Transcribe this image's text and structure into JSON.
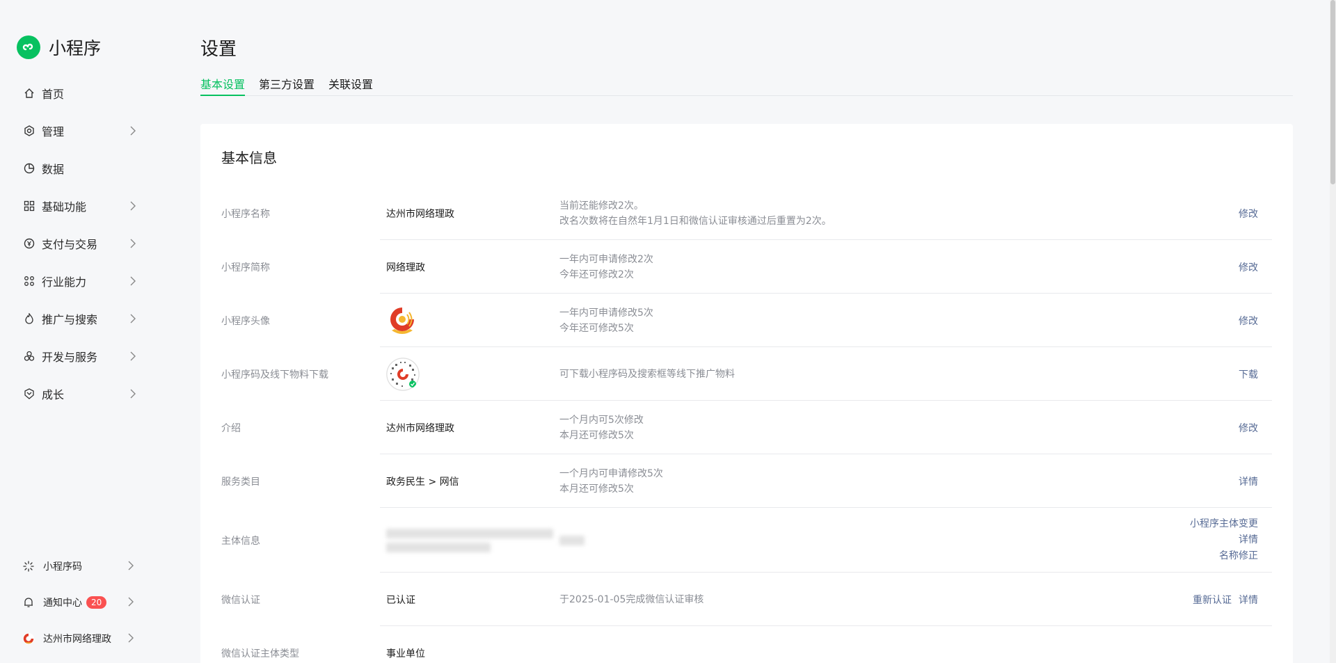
{
  "brand": {
    "title": "小程序"
  },
  "nav": [
    {
      "label": "首页",
      "icon": "home-icon"
    },
    {
      "label": "管理",
      "icon": "settings-icon"
    },
    {
      "label": "数据",
      "icon": "data-pie-icon"
    },
    {
      "label": "基础功能",
      "icon": "grid-icon"
    },
    {
      "label": "支付与交易",
      "icon": "payment-icon"
    },
    {
      "label": "行业能力",
      "icon": "industry-icon"
    },
    {
      "label": "推广与搜索",
      "icon": "promotion-icon"
    },
    {
      "label": "开发与服务",
      "icon": "dev-service-icon"
    },
    {
      "label": "成长",
      "icon": "growth-icon"
    }
  ],
  "bottom_nav": {
    "qrcode": {
      "label": "小程序码",
      "icon": "qrcode-icon"
    },
    "notify": {
      "label": "通知中心",
      "badge": "20",
      "icon": "bell-icon"
    },
    "account": {
      "label": "达州市网络理政",
      "icon": "account-avatar-icon"
    }
  },
  "page": {
    "title": "设置",
    "tabs": [
      "基本设置",
      "第三方设置",
      "关联设置"
    ]
  },
  "card": {
    "title": "基本信息",
    "rows": [
      {
        "label": "小程序名称",
        "value": "达州市网络理政",
        "desc": [
          "当前还能修改2次。",
          "改名次数将在自然年1月1日和微信认证审核通过后重置为2次。"
        ],
        "actions": [
          "修改"
        ]
      },
      {
        "label": "小程序简称",
        "value": "网络理政",
        "desc": [
          "一年内可申请修改2次",
          "今年还可修改2次"
        ],
        "actions": [
          "修改"
        ]
      },
      {
        "label": "小程序头像",
        "value": "",
        "desc": [
          "一年内可申请修改5次",
          "今年还可修改5次"
        ],
        "actions": [
          "修改"
        ]
      },
      {
        "label": "小程序码及线下物料下载",
        "value": "",
        "desc": [
          "可下载小程序码及搜索框等线下推广物料"
        ],
        "actions": [
          "下载"
        ]
      },
      {
        "label": "介绍",
        "value": "达州市网络理政",
        "desc": [
          "一个月内可5次修改",
          "本月还可修改5次"
        ],
        "actions": [
          "修改"
        ]
      },
      {
        "label": "服务类目",
        "value": "政务民生 > 网信",
        "desc": [
          "一个月内可申请修改5次",
          "本月还可修改5次"
        ],
        "actions": [
          "详情"
        ]
      },
      {
        "label": "主体信息",
        "value": "",
        "desc": [],
        "actions": [
          "小程序主体变更",
          "详情",
          "名称修正"
        ]
      },
      {
        "label": "微信认证",
        "value": "已认证",
        "desc": [
          "于2025-01-05完成微信认证审核"
        ],
        "actions": [
          "重新认证",
          "详情"
        ]
      },
      {
        "label": "微信认证主体类型",
        "value": "事业单位",
        "desc": [],
        "actions": []
      }
    ]
  },
  "colors": {
    "accent": "#07c160",
    "link": "#576b95",
    "badge": "#fa5151"
  }
}
